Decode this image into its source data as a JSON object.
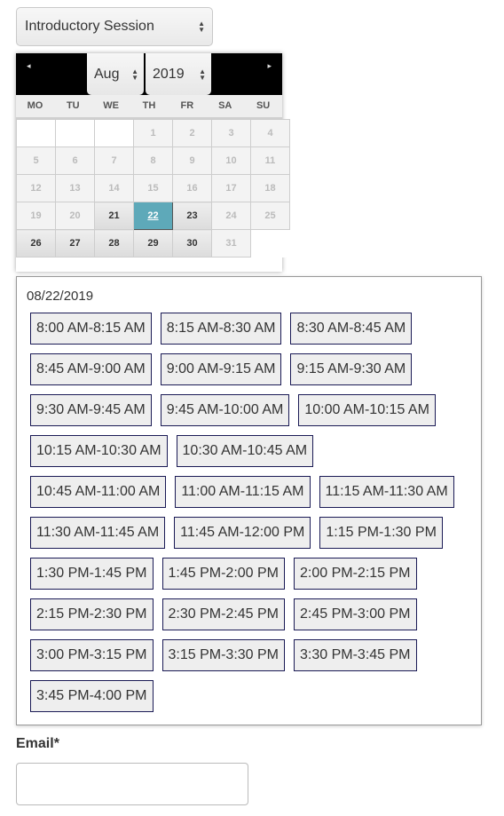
{
  "session_select": {
    "value": "Introductory Session"
  },
  "calendar": {
    "prev_icon": "◂",
    "next_icon": "▸",
    "month": "Aug",
    "year": "2019",
    "weekdays": [
      "MO",
      "TU",
      "WE",
      "TH",
      "FR",
      "SA",
      "SU"
    ],
    "weeks": [
      [
        {
          "d": "",
          "s": "empty"
        },
        {
          "d": "",
          "s": "empty"
        },
        {
          "d": "",
          "s": "empty"
        },
        {
          "d": "1",
          "s": "off"
        },
        {
          "d": "2",
          "s": "off"
        },
        {
          "d": "3",
          "s": "off"
        },
        {
          "d": "4",
          "s": "off"
        }
      ],
      [
        {
          "d": "5",
          "s": "off"
        },
        {
          "d": "6",
          "s": "off"
        },
        {
          "d": "7",
          "s": "off"
        },
        {
          "d": "8",
          "s": "off"
        },
        {
          "d": "9",
          "s": "off"
        },
        {
          "d": "10",
          "s": "off"
        },
        {
          "d": "11",
          "s": "off"
        }
      ],
      [
        {
          "d": "12",
          "s": "off"
        },
        {
          "d": "13",
          "s": "off"
        },
        {
          "d": "14",
          "s": "off"
        },
        {
          "d": "15",
          "s": "off"
        },
        {
          "d": "16",
          "s": "off"
        },
        {
          "d": "17",
          "s": "off"
        },
        {
          "d": "18",
          "s": "off"
        }
      ],
      [
        {
          "d": "19",
          "s": "off"
        },
        {
          "d": "20",
          "s": "off"
        },
        {
          "d": "21",
          "s": "avail"
        },
        {
          "d": "22",
          "s": "sel"
        },
        {
          "d": "23",
          "s": "avail"
        },
        {
          "d": "24",
          "s": "off"
        },
        {
          "d": "25",
          "s": "off"
        }
      ],
      [
        {
          "d": "26",
          "s": "avail"
        },
        {
          "d": "27",
          "s": "avail"
        },
        {
          "d": "28",
          "s": "avail"
        },
        {
          "d": "29",
          "s": "avail"
        },
        {
          "d": "30",
          "s": "avail"
        },
        {
          "d": "31",
          "s": "off"
        },
        {
          "d": "",
          "s": "blank"
        }
      ]
    ]
  },
  "slots": {
    "date": "08/22/2019",
    "times": [
      "8:00 AM-8:15 AM",
      "8:15 AM-8:30 AM",
      "8:30 AM-8:45 AM",
      "8:45 AM-9:00 AM",
      "9:00 AM-9:15 AM",
      "9:15 AM-9:30 AM",
      "9:30 AM-9:45 AM",
      "9:45 AM-10:00 AM",
      "10:00 AM-10:15 AM",
      "10:15 AM-10:30 AM",
      "10:30 AM-10:45 AM",
      "10:45 AM-11:00 AM",
      "11:00 AM-11:15 AM",
      "11:15 AM-11:30 AM",
      "11:30 AM-11:45 AM",
      "11:45 AM-12:00 PM",
      "1:15 PM-1:30 PM",
      "1:30 PM-1:45 PM",
      "1:45 PM-2:00 PM",
      "2:00 PM-2:15 PM",
      "2:15 PM-2:30 PM",
      "2:30 PM-2:45 PM",
      "2:45 PM-3:00 PM",
      "3:00 PM-3:15 PM",
      "3:15 PM-3:30 PM",
      "3:30 PM-3:45 PM",
      "3:45 PM-4:00 PM"
    ]
  },
  "email": {
    "label": "Email*",
    "value": ""
  }
}
